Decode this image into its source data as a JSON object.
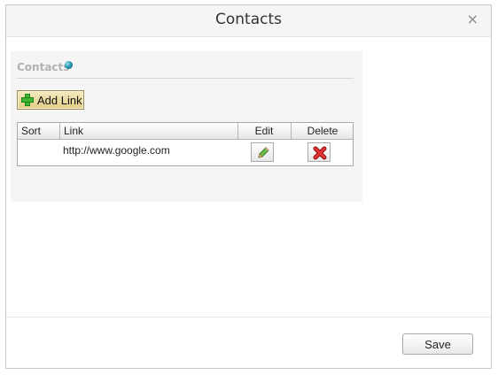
{
  "dialog": {
    "title": "Contacts",
    "close_glyph": "×"
  },
  "section": {
    "title": "Contacts",
    "icon": "globe-icon"
  },
  "toolbar": {
    "add_link_label": "Add Link",
    "add_link_icon": "plus-icon"
  },
  "grid": {
    "columns": [
      "Sort",
      "Link",
      "Edit",
      "Delete"
    ],
    "rows": [
      {
        "sort": "",
        "link": "http://www.google.com",
        "edit_icon": "pencil-icon",
        "delete_icon": "red-x-icon"
      }
    ]
  },
  "footer": {
    "save_label": "Save"
  },
  "colors": {
    "add_button_bg": "#e2cd85",
    "plus_green": "#3cb832",
    "delete_red": "#d62020",
    "pencil_green": "#6cc04a"
  }
}
